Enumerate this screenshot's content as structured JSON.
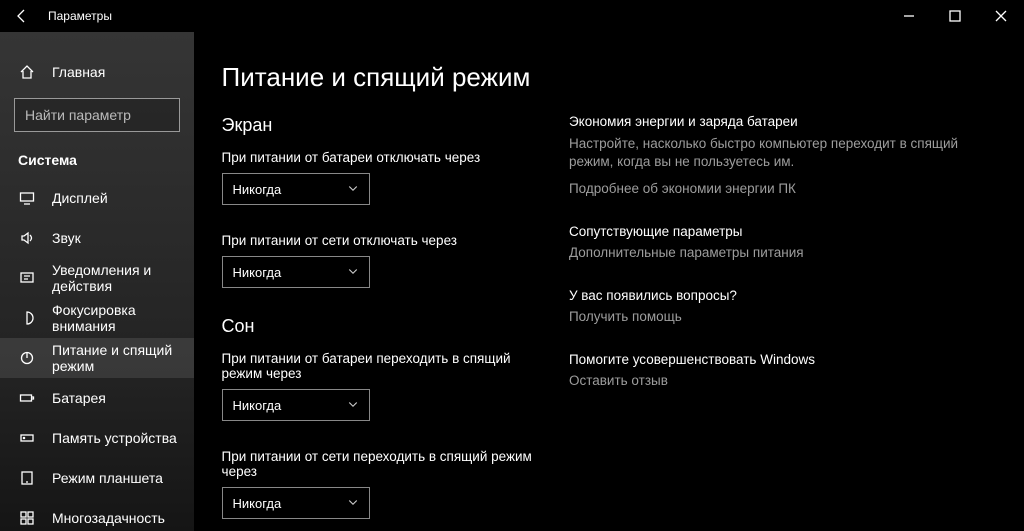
{
  "titlebar": {
    "title": "Параметры"
  },
  "sidebar": {
    "home": "Главная",
    "search_placeholder": "Найти параметр",
    "group": "Система",
    "items": [
      {
        "label": "Дисплей"
      },
      {
        "label": "Звук"
      },
      {
        "label": "Уведомления и действия"
      },
      {
        "label": "Фокусировка внимания"
      },
      {
        "label": "Питание и спящий режим"
      },
      {
        "label": "Батарея"
      },
      {
        "label": "Память устройства"
      },
      {
        "label": "Режим планшета"
      },
      {
        "label": "Многозадачность"
      }
    ]
  },
  "main": {
    "page_title": "Питание и спящий режим",
    "screen_section": "Экран",
    "screen_battery_label": "При питании от батареи отключать через",
    "screen_battery_value": "Никогда",
    "screen_plugged_label": "При питании от сети отключать через",
    "screen_plugged_value": "Никогда",
    "sleep_section": "Сон",
    "sleep_battery_label": "При питании от батареи переходить в спящий режим через",
    "sleep_battery_value": "Никогда",
    "sleep_plugged_label": "При питании от сети переходить в спящий режим через",
    "sleep_plugged_value": "Никогда"
  },
  "info": {
    "energy_head": "Экономия энергии и заряда батареи",
    "energy_desc": "Настройте, насколько быстро компьютер переходит в спящий режим, когда вы не пользуетесь им.",
    "energy_link": "Подробнее об экономии энергии ПК",
    "related_head": "Сопутствующие параметры",
    "related_link": "Дополнительные параметры питания",
    "questions_head": "У вас появились вопросы?",
    "questions_link": "Получить помощь",
    "improve_head": "Помогите усовершенствовать Windows",
    "improve_link": "Оставить отзыв"
  }
}
